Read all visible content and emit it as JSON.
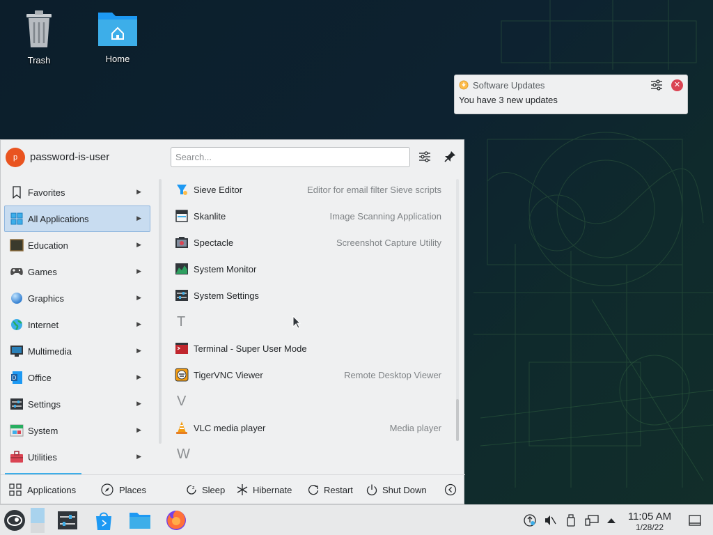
{
  "desktop": {
    "icons": [
      {
        "label": "Trash"
      },
      {
        "label": "Home"
      }
    ]
  },
  "notification": {
    "app_name": "Software Updates",
    "message": "You have 3 new updates"
  },
  "launcher": {
    "username": "password-is-user",
    "avatar_letter": "p",
    "search": {
      "placeholder": "Search..."
    },
    "categories": [
      {
        "label": "Favorites",
        "icon": "bookmark-icon"
      },
      {
        "label": "All Applications",
        "icon": "grid-icon",
        "active": true
      },
      {
        "label": "Education",
        "icon": "chalkboard-icon"
      },
      {
        "label": "Games",
        "icon": "gamepad-icon"
      },
      {
        "label": "Graphics",
        "icon": "sphere-icon"
      },
      {
        "label": "Internet",
        "icon": "globe-icon"
      },
      {
        "label": "Multimedia",
        "icon": "monitor-icon"
      },
      {
        "label": "Office",
        "icon": "document-icon"
      },
      {
        "label": "Settings",
        "icon": "sliders-icon"
      },
      {
        "label": "System",
        "icon": "system-icon"
      },
      {
        "label": "Utilities",
        "icon": "toolbox-icon"
      }
    ],
    "apps": {
      "sieve": {
        "name": "Sieve Editor",
        "desc": "Editor for email filter Sieve scripts"
      },
      "skanlite": {
        "name": "Skanlite",
        "desc": "Image Scanning Application"
      },
      "spectacle": {
        "name": "Spectacle",
        "desc": "Screenshot Capture Utility"
      },
      "sysmon": {
        "name": "System Monitor",
        "desc": ""
      },
      "syssettings": {
        "name": "System Settings",
        "desc": ""
      },
      "section_t": "T",
      "terminal": {
        "name": "Terminal - Super User Mode",
        "desc": ""
      },
      "tigervnc": {
        "name": "TigerVNC Viewer",
        "desc": "Remote Desktop Viewer"
      },
      "section_v": "V",
      "vlc": {
        "name": "VLC media player",
        "desc": "Media player"
      },
      "section_w": "W"
    },
    "footer": {
      "tab_applications": "Applications",
      "tab_places": "Places",
      "sleep": "Sleep",
      "hibernate": "Hibernate",
      "restart": "Restart",
      "shutdown": "Shut Down"
    }
  },
  "taskbar": {
    "clock": {
      "time": "11:05 AM",
      "date": "1/28/22"
    }
  },
  "colors": {
    "accent": "#3daee9",
    "close_red": "#da4453",
    "avatar": "#e95420"
  }
}
